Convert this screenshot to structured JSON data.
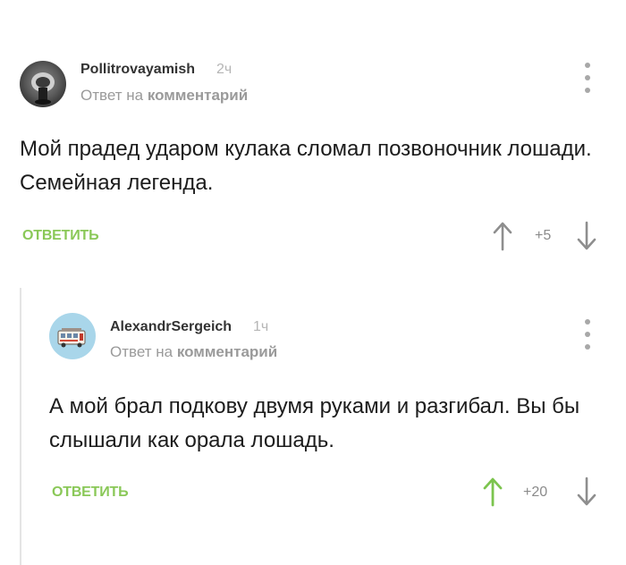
{
  "comments": [
    {
      "username": "Pollitrovayamish",
      "time": "2ч",
      "reply_prefix": "Ответ на",
      "reply_link": "комментарий",
      "text": "Мой прадед ударом кулака сломал позвоночник лошади. Семейная легенда.",
      "reply_label": "ОТВЕТИТЬ",
      "score": "+5",
      "upvote_active": false
    },
    {
      "username": "AlexandrSergeich",
      "time": "1ч",
      "reply_prefix": "Ответ на",
      "reply_link": "комментарий",
      "text": "А мой брал подкову двумя руками и разгибал. Вы бы слышали как орала лошадь.",
      "reply_label": "ОТВЕТИТЬ",
      "score": "+20",
      "upvote_active": true
    }
  ],
  "colors": {
    "accent_green": "#8ac858",
    "vote_gray": "#8e8e8e",
    "upvote_green": "#7cc44e"
  },
  "icons": {
    "more": "vertical-dots-icon",
    "upvote": "arrow-up-icon",
    "downvote": "arrow-down-icon"
  }
}
